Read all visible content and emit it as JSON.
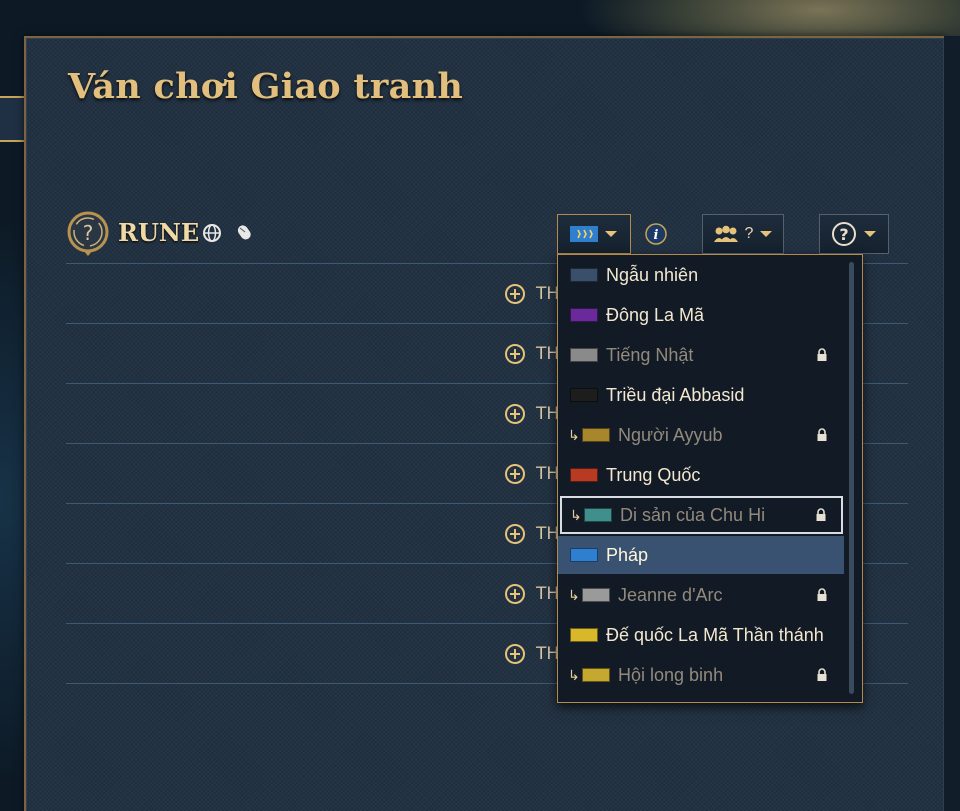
{
  "title": "Ván chơi Giao tranh",
  "player": {
    "name": "RUNE",
    "emblem_icon": "unknown-civ-emblem-icon",
    "civ_button_flag": "france-flag-icon",
    "team_label": "?",
    "color_label": "?"
  },
  "slots": [
    {
      "label": "TH"
    },
    {
      "label": "TH"
    },
    {
      "label": "TH"
    },
    {
      "label": "TH"
    },
    {
      "label": "TH"
    },
    {
      "label": "TH"
    },
    {
      "label": "TH"
    }
  ],
  "civ_dropdown": {
    "items": [
      {
        "label": "Ngẫu nhiên",
        "locked": false,
        "sub": false,
        "flag": "#3a4f6a"
      },
      {
        "label": "Đông La Mã",
        "locked": false,
        "sub": false,
        "flag": "#6b2a9a"
      },
      {
        "label": "Tiếng Nhật",
        "locked": true,
        "sub": false,
        "flag": "#8a8a8a"
      },
      {
        "label": "Triều đại Abbasid",
        "locked": false,
        "sub": false,
        "flag": "#1d1d1d"
      },
      {
        "label": "Người Ayyub",
        "locked": true,
        "sub": true,
        "flag": "#a8872c"
      },
      {
        "label": "Trung Quốc",
        "locked": false,
        "sub": false,
        "flag": "#b73b23"
      },
      {
        "label": "Di sản của Chu Hi",
        "locked": true,
        "sub": true,
        "flag": "#3f8f8c"
      },
      {
        "label": "Pháp",
        "locked": false,
        "sub": false,
        "flag": "#2f7fd0",
        "selected": true
      },
      {
        "label": "Jeanne d'Arc",
        "locked": true,
        "sub": true,
        "flag": "#9a9a9a"
      },
      {
        "label": "Đế quốc La Mã Thần thánh",
        "locked": false,
        "sub": false,
        "flag": "#d8b82a"
      },
      {
        "label": "Hội long binh",
        "locked": true,
        "sub": true,
        "flag": "#c4a82f"
      }
    ]
  }
}
